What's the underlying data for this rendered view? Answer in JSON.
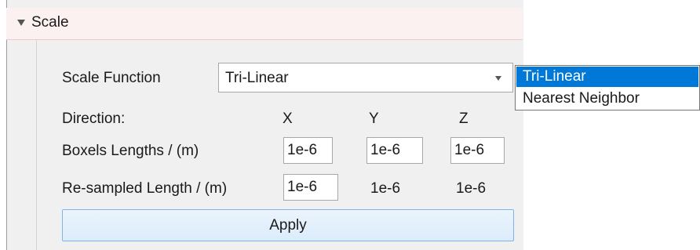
{
  "section": {
    "title": "Scale",
    "expanded": true
  },
  "scale_function": {
    "label": "Scale Function",
    "selected": "Tri-Linear",
    "options": [
      "Tri-Linear",
      "Nearest Neighbor"
    ]
  },
  "direction": {
    "label": "Direction:",
    "x": "X",
    "y": "Y",
    "z": "Z"
  },
  "boxel_lengths": {
    "label": "Boxels Lengths / (m)",
    "x": "1e-6",
    "y": "1e-6",
    "z": "1e-6"
  },
  "resampled_length": {
    "label": "Re-sampled Length / (m)",
    "x": "1e-6",
    "y": "1e-6",
    "z": "1e-6"
  },
  "apply_label": "Apply",
  "colors": {
    "selection": "#0078d7",
    "header_bg": "#fbf1f1",
    "button_border": "#7eb4ea"
  }
}
